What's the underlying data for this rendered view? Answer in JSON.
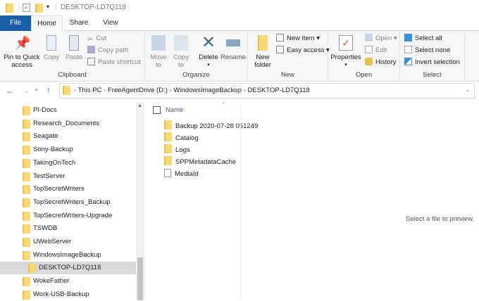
{
  "window": {
    "title": "DESKTOP-LD7Q118"
  },
  "tabs": [
    {
      "label": "File"
    },
    {
      "label": "Home"
    },
    {
      "label": "Share"
    },
    {
      "label": "View"
    }
  ],
  "ribbon": {
    "clipboard": {
      "label": "Clipboard",
      "pin": "Pin to Quick access",
      "pin1": "Pin to Quick",
      "pin2": "access",
      "copy": "Copy",
      "paste": "Paste",
      "cut": "Cut",
      "copy_path": "Copy path",
      "paste_shortcut": "Paste shortcut"
    },
    "organize": {
      "label": "Organize",
      "move1": "Move",
      "move2": "to",
      "copy1": "Copy",
      "copy2": "to",
      "delete": "Delete",
      "rename": "Rename"
    },
    "new": {
      "label": "New",
      "new_folder1": "New",
      "new_folder2": "folder",
      "new_item": "New item",
      "easy_access": "Easy access"
    },
    "open": {
      "label": "Open",
      "properties": "Properties",
      "open": "Open",
      "edit": "Edit",
      "history": "History"
    },
    "select": {
      "label": "Select",
      "select_all": "Select all",
      "select_none": "Select none",
      "invert": "Invert selection"
    }
  },
  "address": {
    "crumbs": [
      "This PC",
      "FreeAgentDrive (D:)",
      "WindowsImageBackup",
      "DESKTOP-LD7Q118"
    ]
  },
  "nav_tree": [
    "PI-Docs",
    "Research_Documents",
    "Seagate",
    "Sony-Backup",
    "TakingOnTech",
    "TestServer",
    "TopSecretWriters",
    "TopSecretWriters_Backup",
    "TopSecretWriters-Upgrade",
    "TSWDB",
    "UWebServer",
    "WindowsImageBackup",
    "DESKTOP-LD7Q118",
    "WokeFather",
    "Work-USB-Backup"
  ],
  "files": {
    "column": "Name",
    "items": [
      {
        "name": "Backup 2020-07-28 051249",
        "type": "folder"
      },
      {
        "name": "Catalog",
        "type": "folder"
      },
      {
        "name": "Logs",
        "type": "folder"
      },
      {
        "name": "SPPMetadataCache",
        "type": "folder"
      },
      {
        "name": "MediaId",
        "type": "file"
      }
    ]
  },
  "preview": {
    "message": "Select a file to preview."
  },
  "colors": {
    "file_tab": "#1a5ea8",
    "selected": "#d9d9d9"
  }
}
